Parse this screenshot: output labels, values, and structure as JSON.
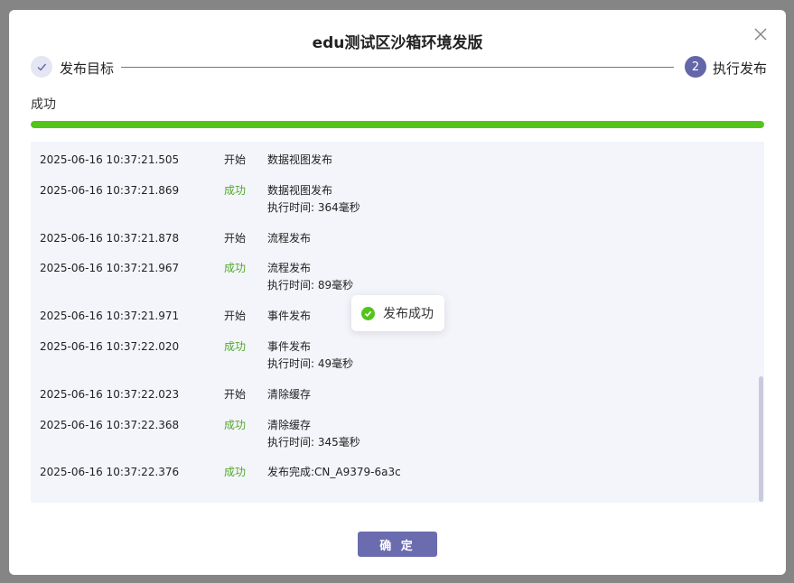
{
  "dialog": {
    "title": "edu测试区沙箱环境发版",
    "close_icon": "close-icon"
  },
  "steps": [
    {
      "index": "",
      "label": "发布目标",
      "state": "done",
      "icon": "check-icon"
    },
    {
      "index": "2",
      "label": "执行发布",
      "state": "active"
    }
  ],
  "status": {
    "text": "成功",
    "progress_percent": 100,
    "progress_color": "#52c41a"
  },
  "logs": [
    {
      "time": "2025-06-16 10:37:21.505",
      "status": "开始",
      "ok": false,
      "message": "数据视图发布",
      "detail": ""
    },
    {
      "time": "2025-06-16 10:37:21.869",
      "status": "成功",
      "ok": true,
      "message": "数据视图发布",
      "detail": "执行时间: 364毫秒"
    },
    {
      "time": "2025-06-16 10:37:21.878",
      "status": "开始",
      "ok": false,
      "message": "流程发布",
      "detail": ""
    },
    {
      "time": "2025-06-16 10:37:21.967",
      "status": "成功",
      "ok": true,
      "message": "流程发布",
      "detail": "执行时间: 89毫秒"
    },
    {
      "time": "2025-06-16 10:37:21.971",
      "status": "开始",
      "ok": false,
      "message": "事件发布",
      "detail": ""
    },
    {
      "time": "2025-06-16 10:37:22.020",
      "status": "成功",
      "ok": true,
      "message": "事件发布",
      "detail": "执行时间: 49毫秒"
    },
    {
      "time": "2025-06-16 10:37:22.023",
      "status": "开始",
      "ok": false,
      "message": "清除缓存",
      "detail": ""
    },
    {
      "time": "2025-06-16 10:37:22.368",
      "status": "成功",
      "ok": true,
      "message": "清除缓存",
      "detail": "执行时间: 345毫秒"
    },
    {
      "time": "2025-06-16 10:37:22.376",
      "status": "成功",
      "ok": true,
      "message": "发布完成:CN_A9379-6a3c",
      "detail": ""
    }
  ],
  "toast": {
    "text": "发布成功",
    "icon": "check-circle-icon"
  },
  "footer": {
    "confirm_label": "确 定"
  },
  "colors": {
    "accent": "#6366a8",
    "success": "#52c41a",
    "success_text": "#52a82a",
    "log_bg": "#f4f5fb"
  }
}
